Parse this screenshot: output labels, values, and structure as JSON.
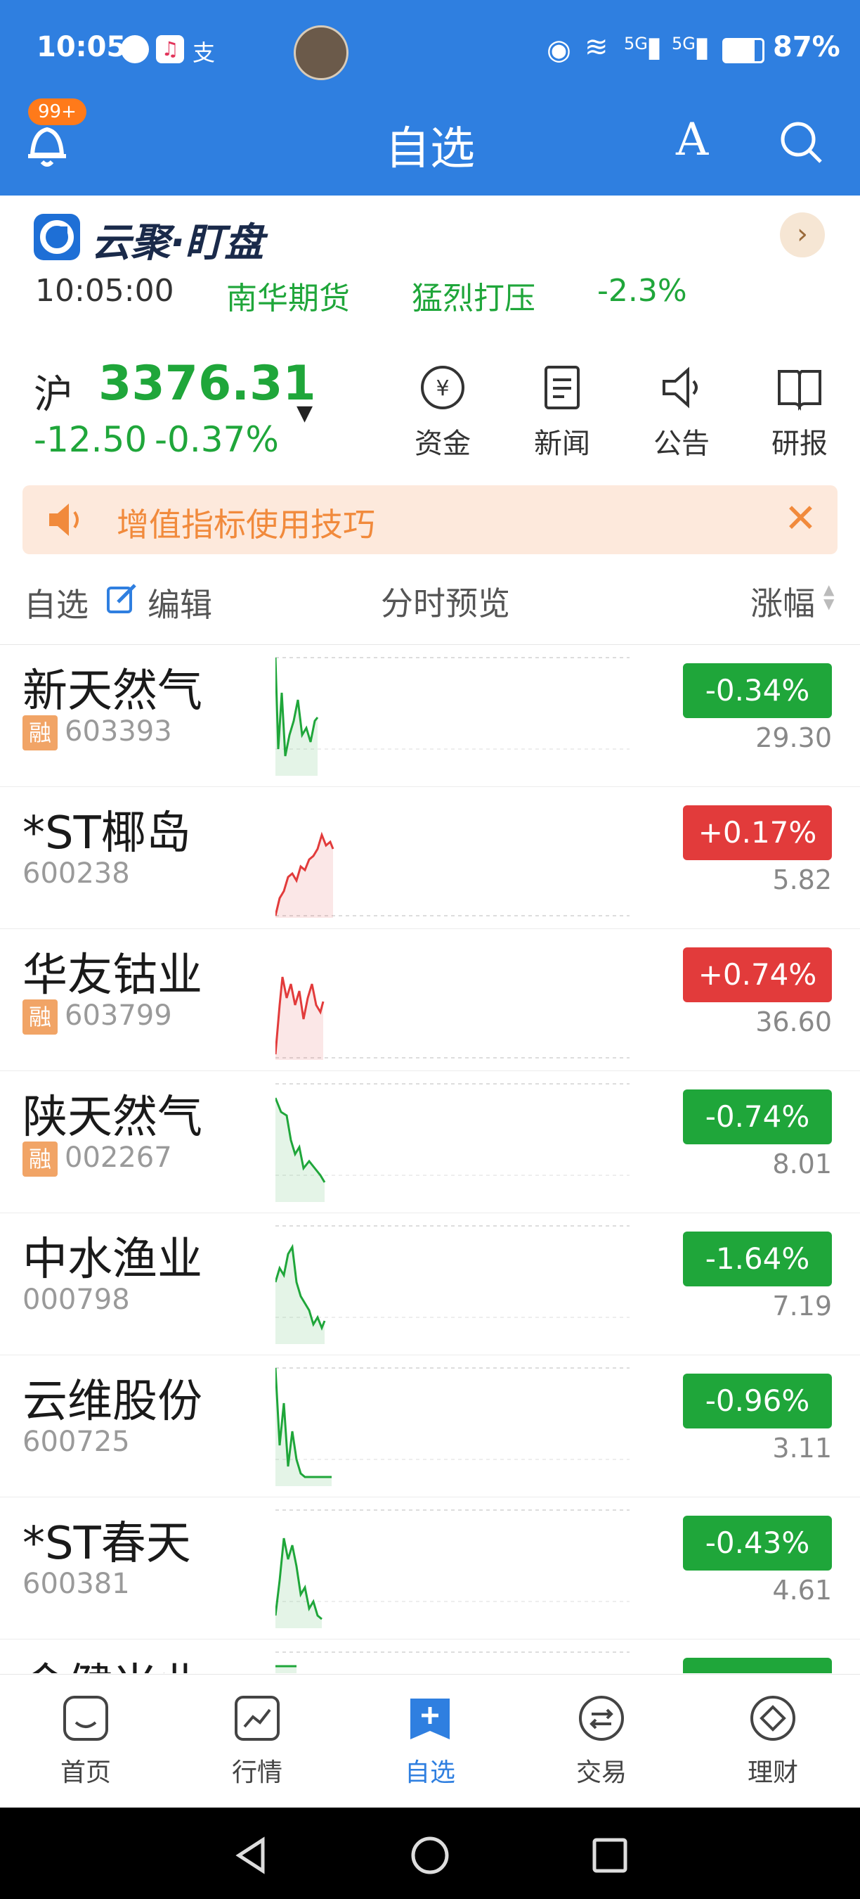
{
  "status_bar": {
    "time": "10:05",
    "network": "5G",
    "battery": "87%"
  },
  "header": {
    "title": "自选",
    "badge": "99+"
  },
  "banner": {
    "brand": "云聚·盯盘",
    "time": "10:05:00",
    "company": "南华期货",
    "status": "猛烈打压",
    "change": "-2.3%"
  },
  "index": {
    "market": "沪",
    "value": "3376.31",
    "change": "-12.50",
    "pct": "-0.37%",
    "actions": [
      {
        "label": "资金",
        "icon": "yen-circle-icon"
      },
      {
        "label": "新闻",
        "icon": "news-icon"
      },
      {
        "label": "公告",
        "icon": "speaker-icon"
      },
      {
        "label": "研报",
        "icon": "book-icon"
      }
    ]
  },
  "tip": {
    "text": "增值指标使用技巧"
  },
  "list_header": {
    "col1": "自选",
    "edit": "编辑",
    "col2": "分时预览",
    "col3": "涨幅"
  },
  "stocks": [
    {
      "name": "新天然气",
      "code": "603393",
      "rong": true,
      "pct": "-0.34%",
      "price": "29.30",
      "up": false
    },
    {
      "name": "*ST椰岛",
      "code": "600238",
      "rong": false,
      "pct": "+0.17%",
      "price": "5.82",
      "up": true
    },
    {
      "name": "华友钴业",
      "code": "603799",
      "rong": true,
      "pct": "+0.74%",
      "price": "36.60",
      "up": true
    },
    {
      "name": "陕天然气",
      "code": "002267",
      "rong": true,
      "pct": "-0.74%",
      "price": "8.01",
      "up": false
    },
    {
      "name": "中水渔业",
      "code": "000798",
      "rong": false,
      "pct": "-1.64%",
      "price": "7.19",
      "up": false
    },
    {
      "name": "云维股份",
      "code": "600725",
      "rong": false,
      "pct": "-0.96%",
      "price": "3.11",
      "up": false
    },
    {
      "name": "*ST春天",
      "code": "600381",
      "rong": false,
      "pct": "-0.43%",
      "price": "4.61",
      "up": false
    },
    {
      "name": "金健米业",
      "code": "",
      "rong": false,
      "pct": "",
      "price": "",
      "up": false
    }
  ],
  "rong_label": "融",
  "nav": [
    {
      "label": "首页",
      "icon": "home-icon",
      "active": false
    },
    {
      "label": "行情",
      "icon": "chart-icon",
      "active": false
    },
    {
      "label": "自选",
      "icon": "watchlist-icon",
      "active": true
    },
    {
      "label": "交易",
      "icon": "exchange-icon",
      "active": false
    },
    {
      "label": "理财",
      "icon": "finance-icon",
      "active": false
    }
  ],
  "colors": {
    "brand_blue": "#2f7fe0",
    "up_red": "#e23b3b",
    "down_green": "#1fa63a",
    "tip_orange": "#f18a3c"
  }
}
